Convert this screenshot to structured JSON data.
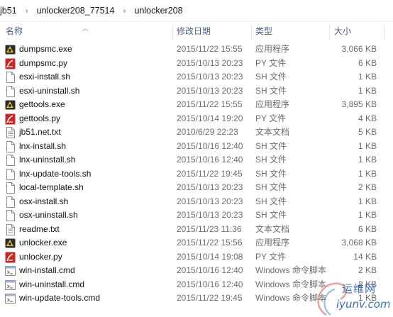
{
  "breadcrumb": {
    "segments": [
      "jb51",
      "unlocker208_77514",
      "unlocker208"
    ]
  },
  "columns": {
    "name": "名称",
    "date": "修改日期",
    "type": "类型",
    "size": "大小"
  },
  "files": [
    {
      "name": "dumpsmc.exe",
      "date": "2015/11/22 15:55",
      "type": "应用程序",
      "size": "3,066 KB",
      "icon": "exe-app-icon"
    },
    {
      "name": "dumpsmc.py",
      "date": "2015/10/13 20:23",
      "type": "PY 文件",
      "size": "6 KB",
      "icon": "python-file-icon"
    },
    {
      "name": "esxi-install.sh",
      "date": "2015/10/13 20:23",
      "type": "SH 文件",
      "size": "1 KB",
      "icon": "blank-file-icon"
    },
    {
      "name": "esxi-uninstall.sh",
      "date": "2015/10/13 20:23",
      "type": "SH 文件",
      "size": "1 KB",
      "icon": "blank-file-icon"
    },
    {
      "name": "gettools.exe",
      "date": "2015/11/22 15:55",
      "type": "应用程序",
      "size": "3,895 KB",
      "icon": "exe-app-icon"
    },
    {
      "name": "gettools.py",
      "date": "2015/10/14 19:20",
      "type": "PY 文件",
      "size": "4 KB",
      "icon": "python-file-icon"
    },
    {
      "name": "jb51.net.txt",
      "date": "2010/6/29 22:23",
      "type": "文本文档",
      "size": "5 KB",
      "icon": "text-file-icon"
    },
    {
      "name": "lnx-install.sh",
      "date": "2015/10/16 12:40",
      "type": "SH 文件",
      "size": "1 KB",
      "icon": "blank-file-icon"
    },
    {
      "name": "lnx-uninstall.sh",
      "date": "2015/10/16 12:40",
      "type": "SH 文件",
      "size": "1 KB",
      "icon": "blank-file-icon"
    },
    {
      "name": "lnx-update-tools.sh",
      "date": "2015/11/22 19:45",
      "type": "SH 文件",
      "size": "1 KB",
      "icon": "blank-file-icon"
    },
    {
      "name": "local-template.sh",
      "date": "2015/10/13 20:23",
      "type": "SH 文件",
      "size": "2 KB",
      "icon": "blank-file-icon"
    },
    {
      "name": "osx-install.sh",
      "date": "2015/10/13 20:23",
      "type": "SH 文件",
      "size": "1 KB",
      "icon": "blank-file-icon"
    },
    {
      "name": "osx-uninstall.sh",
      "date": "2015/10/13 20:23",
      "type": "SH 文件",
      "size": "1 KB",
      "icon": "blank-file-icon"
    },
    {
      "name": "readme.txt",
      "date": "2015/11/23 11:36",
      "type": "文本文档",
      "size": "6 KB",
      "icon": "text-file-icon"
    },
    {
      "name": "unlocker.exe",
      "date": "2015/11/22 15:56",
      "type": "应用程序",
      "size": "3,068 KB",
      "icon": "exe-app-icon"
    },
    {
      "name": "unlocker.py",
      "date": "2015/10/14 19:08",
      "type": "PY 文件",
      "size": "14 KB",
      "icon": "python-file-icon"
    },
    {
      "name": "win-install.cmd",
      "date": "2015/10/16 12:40",
      "type": "Windows 命令脚本",
      "size": "2 KB",
      "icon": "cmd-script-icon"
    },
    {
      "name": "win-uninstall.cmd",
      "date": "2015/10/16 12:40",
      "type": "Windows 命令脚本",
      "size": "2 KB",
      "icon": "cmd-script-icon"
    },
    {
      "name": "win-update-tools.cmd",
      "date": "2015/11/22 19:45",
      "type": "Windows 命令脚本",
      "size": "1 KB",
      "icon": "cmd-script-icon"
    }
  ],
  "watermark": {
    "line1": "运维网",
    "line2": "iyunv.com"
  }
}
